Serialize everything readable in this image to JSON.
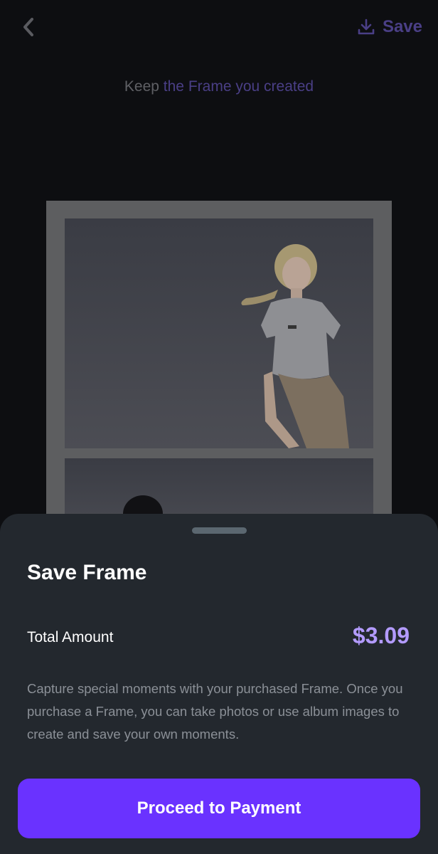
{
  "header": {
    "save_label": "Save",
    "back_icon": "chevron-left-icon",
    "save_icon": "download-icon"
  },
  "subtitle": {
    "prefix": "Keep",
    "accent": "the Frame you created"
  },
  "sheet": {
    "title": "Save Frame",
    "total_label": "Total Amount",
    "total_value": "$3.09",
    "description": "Capture special moments with your purchased Frame. Once you purchase a Frame, you can take photos or use album images to create and save your own moments.",
    "button_label": "Proceed to Payment"
  },
  "colors": {
    "accent": "#6a32ff",
    "price": "#b39bff",
    "sheet_bg": "#23282e",
    "page_bg": "#0d0e11"
  }
}
